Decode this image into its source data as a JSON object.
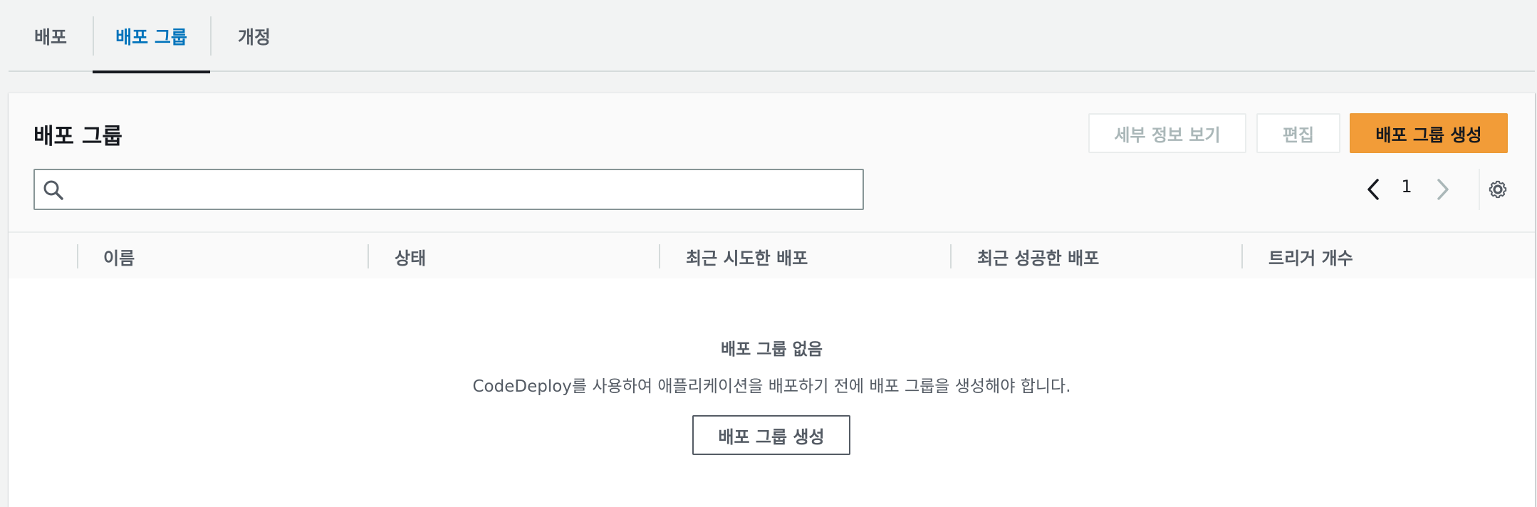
{
  "tabs": [
    {
      "label": "배포",
      "active": false
    },
    {
      "label": "배포 그룹",
      "active": true
    },
    {
      "label": "개정",
      "active": false
    }
  ],
  "panel": {
    "title": "배포 그룹",
    "buttons": {
      "view_details": "세부 정보 보기",
      "edit": "편집",
      "create": "배포 그룹 생성"
    },
    "search": {
      "value": "",
      "placeholder": ""
    },
    "pagination": {
      "current_page": "1"
    },
    "columns": [
      "이름",
      "상태",
      "최근 시도한 배포",
      "최근 성공한 배포",
      "트리거 개수"
    ],
    "empty_state": {
      "title": "배포 그룹 없음",
      "description": "CodeDeploy를 사용하여 애플리케이션을 배포하기 전에 배포 그룹을 생성해야 합니다.",
      "button": "배포 그룹 생성"
    }
  },
  "colors": {
    "accent_tab": "#0073bb",
    "primary_button": "#f29c38",
    "disabled_text": "#aab7b8"
  },
  "icons": [
    "search-icon",
    "chevron-left-icon",
    "chevron-right-icon",
    "gear-icon"
  ]
}
